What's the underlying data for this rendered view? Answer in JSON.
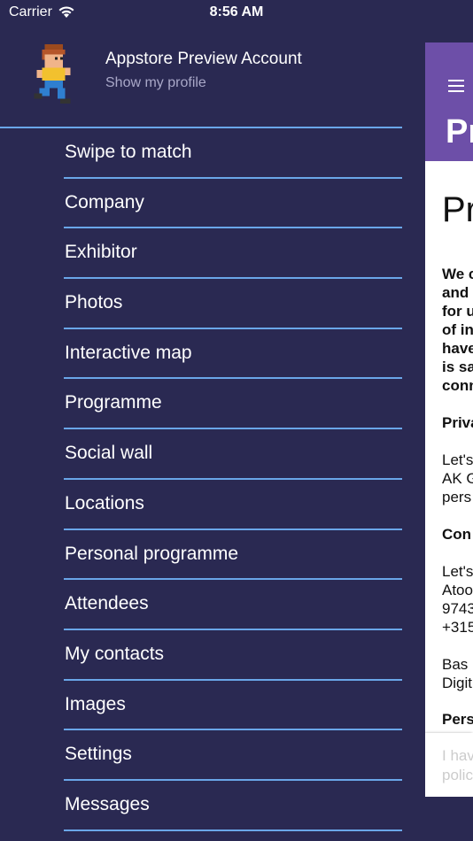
{
  "status": {
    "carrier": "Carrier",
    "time": "8:56 AM"
  },
  "profile": {
    "name": "Appstore Preview Account",
    "link": "Show my profile"
  },
  "menu": [
    "Swipe to match",
    "Company",
    "Exhibitor",
    "Photos",
    "Interactive map",
    "Programme",
    "Social wall",
    "Locations",
    "Personal programme",
    "Attendees",
    "My contacts",
    "Images",
    "Settings",
    "Messages"
  ],
  "page": {
    "header_title": "Pr",
    "title": "Pr",
    "lines": [
      "We c",
      "and",
      "for u",
      "of in",
      "have",
      "is sa",
      "conn",
      "Priva",
      "Let's",
      "AK G",
      "pers",
      "Con",
      "Let's",
      "Atoo",
      "9743",
      "+315",
      "Bas",
      "Digit",
      "Pers"
    ],
    "card_lines": [
      "I hav",
      "polic"
    ]
  },
  "colors": {
    "drawer_bg": "#2a2952",
    "divider": "#6aa6e8",
    "header": "#6d4fa8"
  }
}
